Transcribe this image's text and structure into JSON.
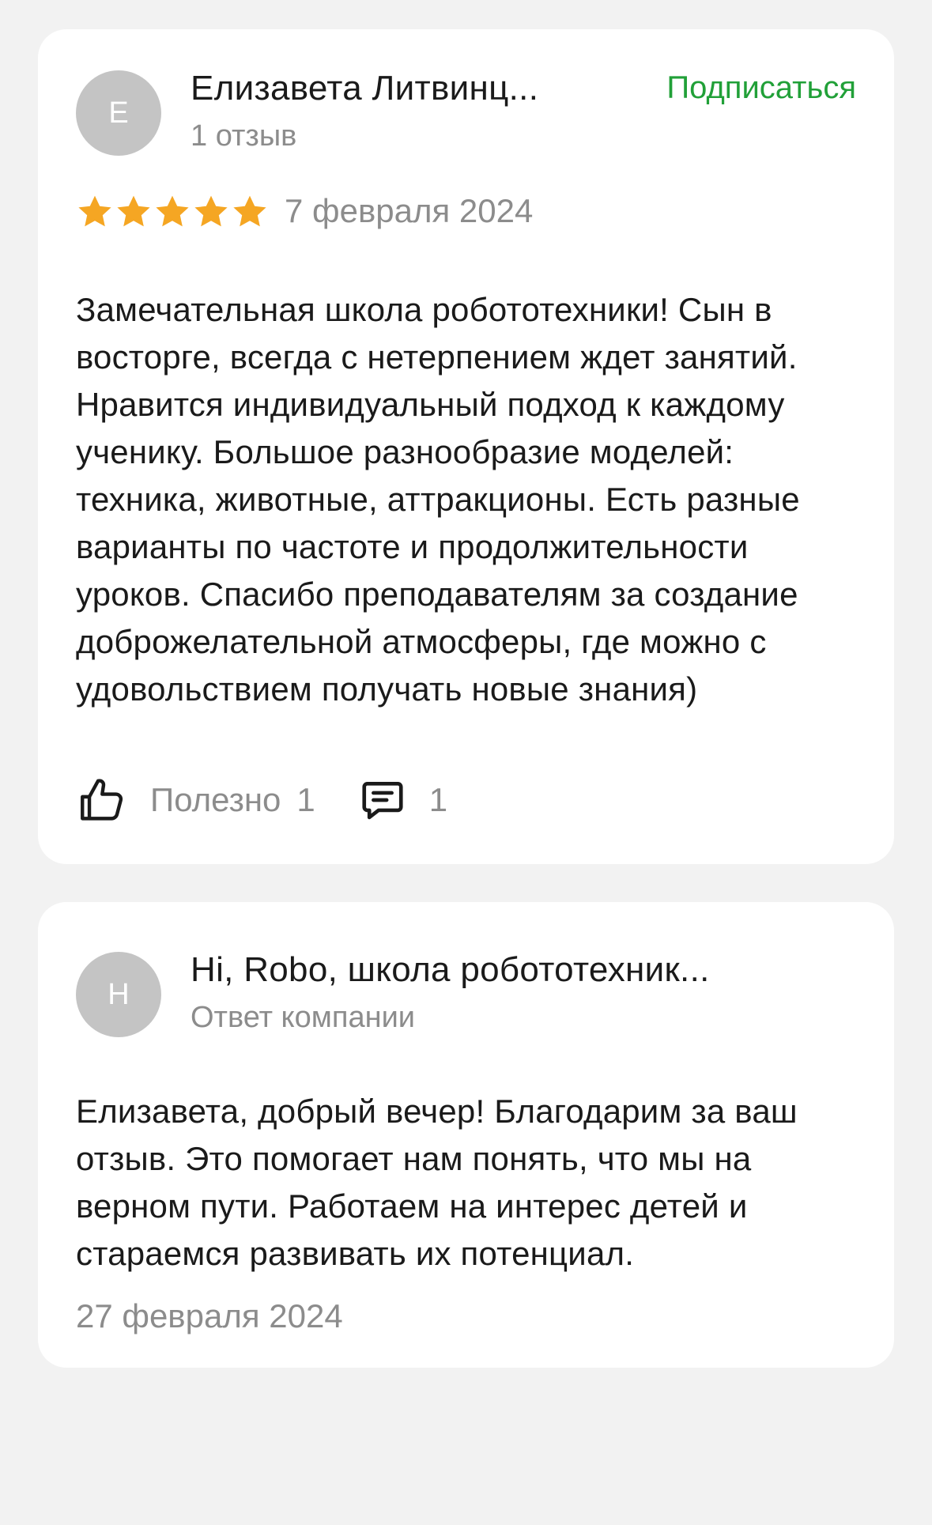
{
  "colors": {
    "accent_green": "#21a038",
    "star_gold": "#f5a623",
    "muted_text": "#8c8c8c",
    "avatar_bg": "#c4c4c4",
    "card_bg": "#ffffff",
    "page_bg": "#f2f2f2"
  },
  "review": {
    "author": {
      "initial": "Е",
      "name": "Елизавета Литвинц...",
      "reviews_count": "1 отзыв"
    },
    "subscribe_label": "Подписаться",
    "rating": 5,
    "rating_max": 5,
    "date": "7 февраля 2024",
    "text": "Замечательная школа робототехники! Сын в восторге, всегда с нетерпением ждет занятий. Нравится индивидуальный подход к каждому ученику. Большое разнообразие моделей: техника, животные, аттракционы. Есть разные варианты по частоте и продолжительности уроков. Спасибо преподавателям за создание доброжелательной атмосферы, где можно с удовольствием получать новые знания)",
    "useful_label": "Полезно",
    "useful_count": "1",
    "comments_count": "1",
    "icons": {
      "like": "thumbs-up-icon",
      "comment": "comment-icon",
      "star": "star-icon"
    }
  },
  "reply": {
    "author": {
      "initial": "H",
      "name": "Hi, Robo, школа робототехник...",
      "role": "Ответ компании"
    },
    "text": "Елизавета, добрый вечер! Благодарим за ваш отзыв. Это помогает нам понять, что мы на верном пути. Работаем на интерес детей и стараемся развивать их потенциал.",
    "date": "27 февраля 2024"
  }
}
